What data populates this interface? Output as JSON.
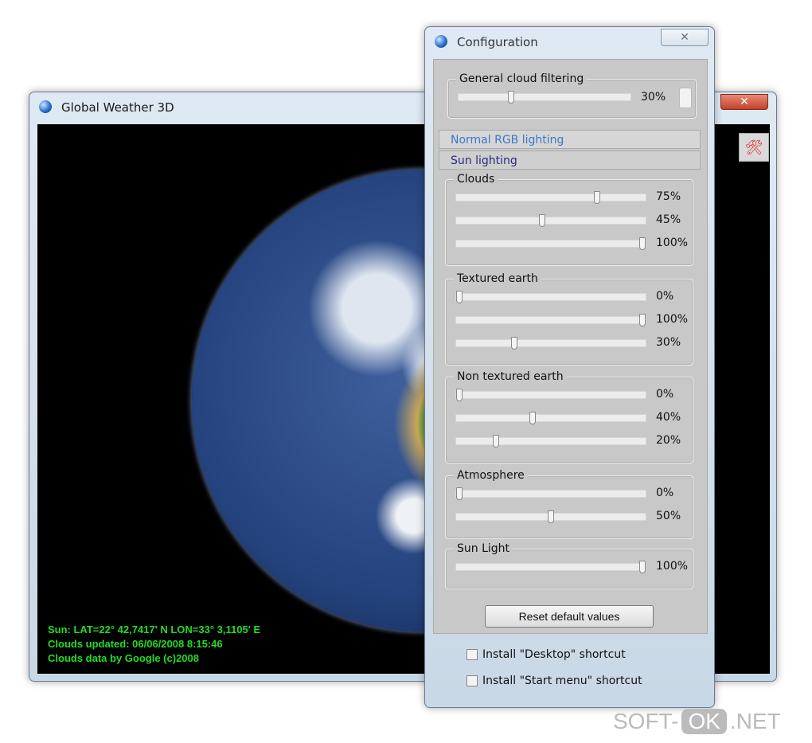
{
  "main_window": {
    "title": "Global Weather 3D",
    "close_label": "✕",
    "status": [
      "Sun: LAT=22° 42,7417' N  LON=33° 3,1105' E",
      "Clouds updated: 06/06/2008 8:15:46",
      "Clouds data by Google (c)2008"
    ],
    "tool_icon": "tools-icon"
  },
  "config": {
    "title": "Configuration",
    "close_label": "✕",
    "cloud_filtering": {
      "label": "General cloud filtering",
      "value": 30,
      "value_label": "30%"
    },
    "tabs": [
      {
        "label": "Normal RGB lighting",
        "color": "#3a78c8"
      },
      {
        "label": "Sun lighting",
        "color": "#2a2a80"
      }
    ],
    "groups": [
      {
        "label": "Clouds",
        "sliders": [
          {
            "value": 75,
            "label": "75%"
          },
          {
            "value": 45,
            "label": "45%"
          },
          {
            "value": 100,
            "label": "100%"
          }
        ]
      },
      {
        "label": "Textured earth",
        "sliders": [
          {
            "value": 0,
            "label": "0%"
          },
          {
            "value": 100,
            "label": "100%"
          },
          {
            "value": 30,
            "label": "30%"
          }
        ]
      },
      {
        "label": "Non textured earth",
        "sliders": [
          {
            "value": 0,
            "label": "0%"
          },
          {
            "value": 40,
            "label": "40%"
          },
          {
            "value": 20,
            "label": "20%"
          }
        ]
      },
      {
        "label": "Atmosphere",
        "sliders": [
          {
            "value": 0,
            "label": "0%"
          },
          {
            "value": 50,
            "label": "50%"
          }
        ]
      },
      {
        "label": "Sun Light",
        "sliders": [
          {
            "value": 100,
            "label": "100%"
          }
        ]
      }
    ],
    "reset_label": "Reset default values",
    "checkboxes": [
      {
        "label": "Install \"Desktop\" shortcut",
        "checked": false
      },
      {
        "label": "Install \"Start menu\" shortcut",
        "checked": false
      }
    ]
  },
  "watermark": {
    "left": "SOFT-",
    "mid": "OK",
    "right": ".NET"
  }
}
